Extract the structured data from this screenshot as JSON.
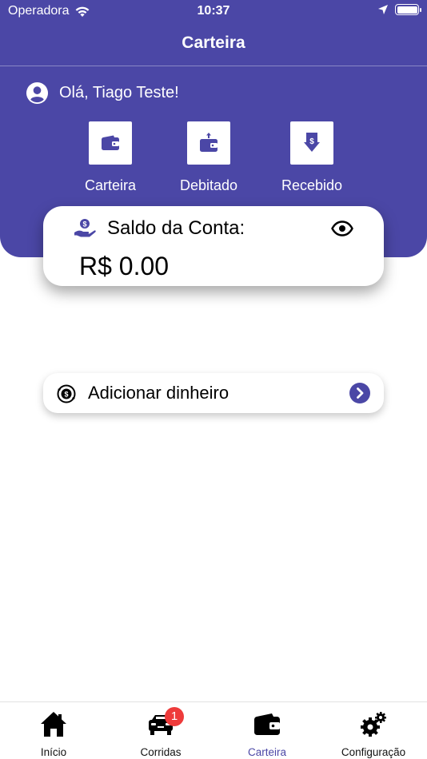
{
  "status_bar": {
    "carrier": "Operadora",
    "time": "10:37"
  },
  "header": {
    "title": "Carteira",
    "greeting": "Olá, Tiago Teste!"
  },
  "quick_actions": [
    {
      "label": "Carteira",
      "icon": "wallet-icon"
    },
    {
      "label": "Debitado",
      "icon": "wallet-out-icon"
    },
    {
      "label": "Recebido",
      "icon": "money-in-icon"
    }
  ],
  "balance": {
    "label": "Saldo da Conta:",
    "value": "R$ 0.00",
    "icon": "hand-coin-icon",
    "toggle_icon": "eye-icon"
  },
  "add_money": {
    "label": "Adicionar dinheiro",
    "icon": "money-cycle-icon",
    "arrow_icon": "chevron-right-circle-icon"
  },
  "colors": {
    "primary": "#4b47a6",
    "badge": "#ee3b3b"
  },
  "tabs": [
    {
      "label": "Início",
      "icon": "home-icon"
    },
    {
      "label": "Corridas",
      "icon": "car-icon",
      "badge": "1"
    },
    {
      "label": "Carteira",
      "icon": "wallet-icon",
      "active": true
    },
    {
      "label": "Configuração",
      "icon": "gears-icon"
    }
  ]
}
